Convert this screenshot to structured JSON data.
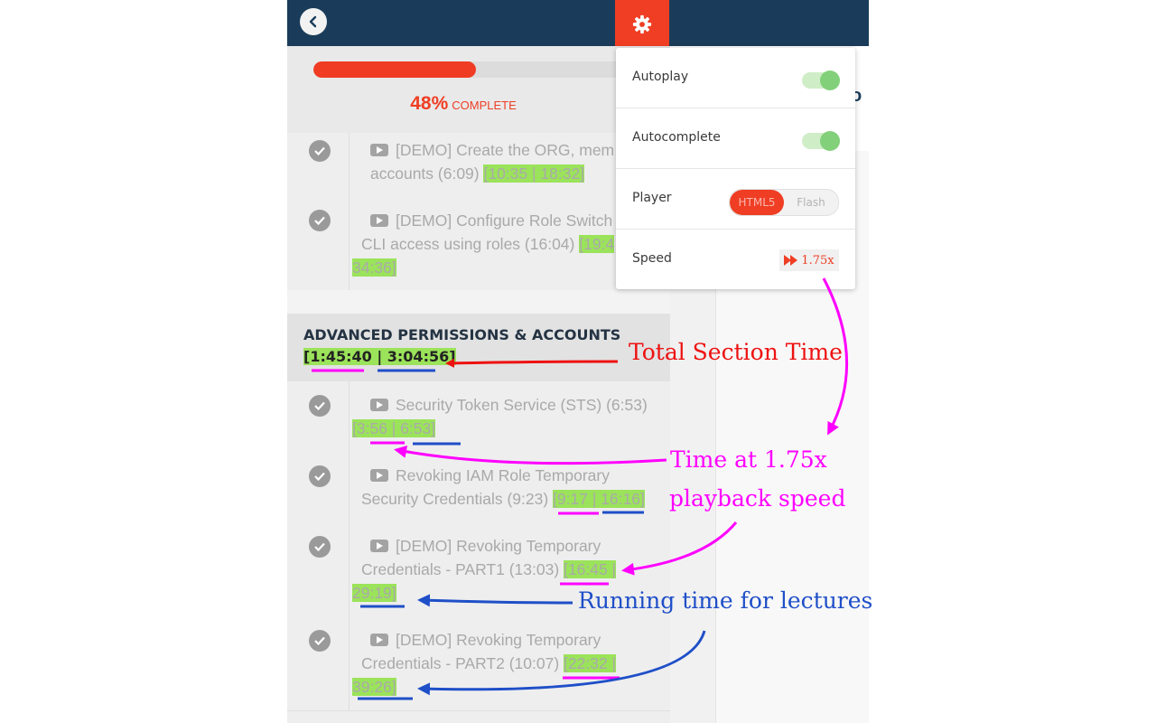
{
  "progress": {
    "percent_value": 48,
    "percent_text": "48%",
    "label": "COMPLETE"
  },
  "lectures_top": [
    {
      "title": "[DEMO] Create the ORG, mem",
      "line2": "accounts (6:09) ",
      "time": "[10:35 | 18:32]",
      "status": "completed"
    },
    {
      "title": "[DEMO] Configure Role Switch",
      "line2": "CLI access using roles (16:04) ",
      "time_a": "[19:4",
      "time_b": "34:36]",
      "status": "completed"
    }
  ],
  "section": {
    "title": "ADVANCED PERMISSIONS & ACCOUNTS",
    "time_open": "[",
    "time_fast": "1:45:40",
    "time_sep": " | ",
    "time_total": "3:04:56",
    "time_close": "]"
  },
  "lectures_section": [
    {
      "line1": "Security Token Service (STS) (6:53)",
      "time": "[3:56 | 6:53]",
      "status": "completed"
    },
    {
      "line1": "Revoking IAM Role Temporary",
      "line2": "Security Credentials (9:23) ",
      "time": "[9:17 | 16:16]",
      "status": "completed"
    },
    {
      "line1": "[DEMO] Revoking Temporary",
      "line2": "Credentials - PART1 (13:03) ",
      "time_a": "[16:45 |",
      "time_b": "29:19]",
      "status": "completed"
    },
    {
      "line1": "[DEMO] Revoking Temporary",
      "line2": "Credentials - PART2 (10:07) ",
      "time_a": "[22:32 |",
      "time_b": "39:26]",
      "status": "completed"
    }
  ],
  "settings": {
    "autoplay": {
      "label": "Autoplay",
      "on": true
    },
    "autocomplete": {
      "label": "Autocomplete",
      "on": true
    },
    "player": {
      "label": "Player",
      "options": [
        "HTML5",
        "Flash"
      ],
      "selected": "HTML5"
    },
    "speed": {
      "label": "Speed",
      "value": "1.75x"
    }
  },
  "partial_heading_glyph": "o",
  "annotations": {
    "total_section": "Total Section Time",
    "speed_line1": "Time at 1.75x",
    "speed_line2": "playback speed",
    "running": "Running time for lectures",
    "colors": {
      "red": "#ee1111",
      "magenta": "#ff00ff",
      "blue": "#1f4fc8"
    }
  }
}
